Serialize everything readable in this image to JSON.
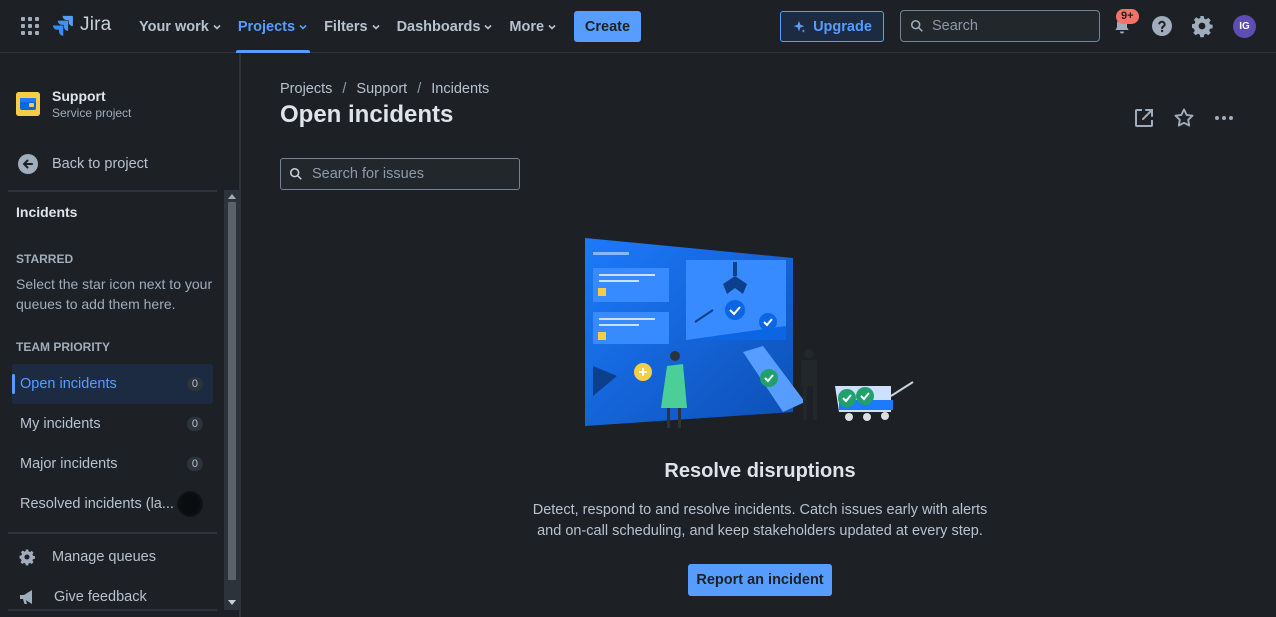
{
  "topnav": {
    "app_name": "Jira",
    "items": [
      {
        "label": "Your work",
        "active": false
      },
      {
        "label": "Projects",
        "active": true
      },
      {
        "label": "Filters",
        "active": false
      },
      {
        "label": "Dashboards",
        "active": false
      },
      {
        "label": "More",
        "active": false
      }
    ],
    "create_label": "Create",
    "upgrade_label": "Upgrade",
    "search_placeholder": "Search",
    "notifications_badge": "9+",
    "avatar_initials": "IG"
  },
  "sidebar": {
    "project_name": "Support",
    "project_type": "Service project",
    "back_label": "Back to project",
    "title": "Incidents",
    "starred_label": "STARRED",
    "starred_note": "Select the star icon next to your queues to add them here.",
    "team_priority_label": "TEAM PRIORITY",
    "queues": [
      {
        "label": "Open incidents",
        "count": "0",
        "active": true
      },
      {
        "label": "My incidents",
        "count": "0",
        "active": false
      },
      {
        "label": "Major incidents",
        "count": "0",
        "active": false
      },
      {
        "label": "Resolved incidents (la...",
        "count": "",
        "active": false
      }
    ],
    "manage_label": "Manage queues",
    "feedback_label": "Give feedback"
  },
  "main": {
    "breadcrumb": [
      "Projects",
      "Support",
      "Incidents"
    ],
    "title": "Open incidents",
    "search_placeholder": "Search for issues",
    "empty_title": "Resolve disruptions",
    "empty_desc_line1": "Detect, respond to and resolve incidents. Catch issues early with alerts",
    "empty_desc_line2": "and on-call scheduling, and keep stakeholders updated at every step.",
    "report_label": "Report an incident"
  },
  "colors": {
    "background": "#1d2125",
    "accent": "#579dff",
    "badge": "#f87168",
    "avatar": "#5e4db2",
    "project_icon": "#f5cd47"
  }
}
